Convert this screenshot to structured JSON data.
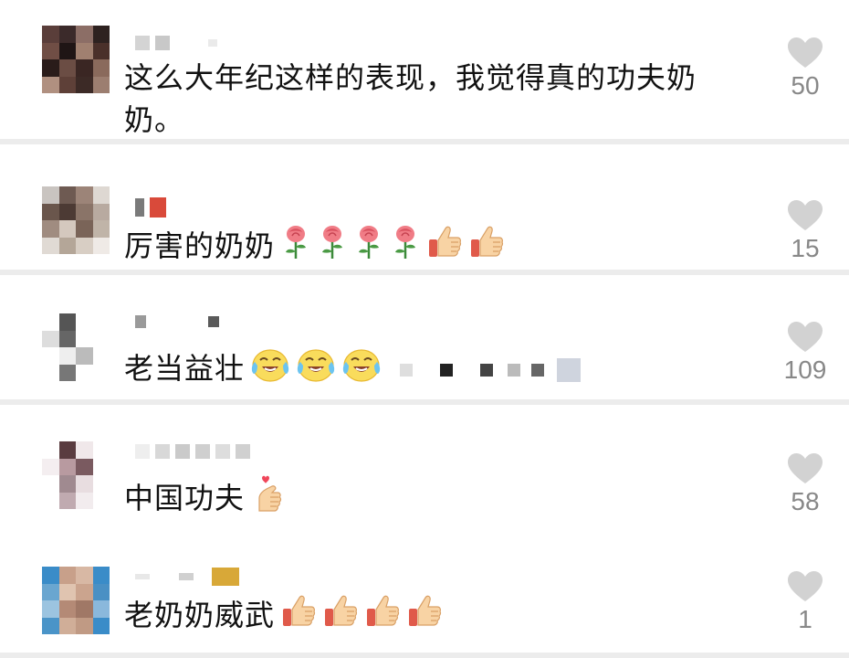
{
  "comments": [
    {
      "text": "这么大年纪这样的表现，我觉得真的功夫奶",
      "text2": "奶。",
      "likes": "50",
      "avatar_colors": [
        "#5a3e3a",
        "#3b2a2a",
        "#8c6e66",
        "#2e2220",
        "#704e45",
        "#1f1515",
        "#a08070",
        "#4a302a",
        "#2a1c1a",
        "#6b4d44",
        "#3a2623",
        "#8a6a5c",
        "#b09080",
        "#5e4038",
        "#3c2a26",
        "#9c7e70"
      ],
      "emojis": []
    },
    {
      "text": "厉害的奶奶",
      "likes": "15",
      "avatar_colors": [
        "#c9c4c0",
        "#6e5a52",
        "#9c8478",
        "#ded8d2",
        "#6a564c",
        "#4c3a34",
        "#8a7468",
        "#b8aaa0",
        "#a08c80",
        "#d4c8be",
        "#7a6458",
        "#c0b4a8",
        "#e0dad4",
        "#b4a698",
        "#d8cec4",
        "#efeae6"
      ],
      "emojis": [
        "rose-icon",
        "rose-icon",
        "rose-icon",
        "rose-icon",
        "thumbs-up-icon",
        "thumbs-up-icon"
      ]
    },
    {
      "text": "老当益壮",
      "likes": "109",
      "avatar_colors": [
        "#ffffff",
        "#555555",
        "#ffffff",
        "#ffffff",
        "#dddddd",
        "#666666",
        "#ffffff",
        "#ffffff",
        "#ffffff",
        "#eeeeee",
        "#bbbbbb",
        "#ffffff",
        "#ffffff",
        "#777777",
        "#ffffff",
        "#ffffff"
      ],
      "emojis": [
        "laugh-cry-icon",
        "laugh-cry-icon",
        "laugh-cry-icon"
      ]
    },
    {
      "text": "中国功夫",
      "likes": "58",
      "avatar_colors": [
        "#ffffff",
        "#5a3c40",
        "#f0e8ea",
        "#ffffff",
        "#f4eef0",
        "#b89aa0",
        "#7a5a60",
        "#ffffff",
        "#ffffff",
        "#a08a90",
        "#e8dde0",
        "#ffffff",
        "#ffffff",
        "#c0aab0",
        "#f2ecee",
        "#ffffff"
      ],
      "emojis": [
        "finger-heart-icon"
      ]
    },
    {
      "text": "老奶奶威武",
      "likes": "1",
      "avatar_colors": [
        "#3a8cc8",
        "#c8a08a",
        "#d8b8a4",
        "#3a8cc8",
        "#6aa6d0",
        "#e0c4b0",
        "#cba48e",
        "#4a90c4",
        "#9cc4e0",
        "#b48a76",
        "#a07866",
        "#8ab8dc",
        "#4a94c8",
        "#d0ae98",
        "#c09a84",
        "#3a8cc8"
      ],
      "emojis": [
        "thumbs-up-icon",
        "thumbs-up-icon",
        "thumbs-up-icon",
        "thumbs-up-icon"
      ]
    }
  ]
}
